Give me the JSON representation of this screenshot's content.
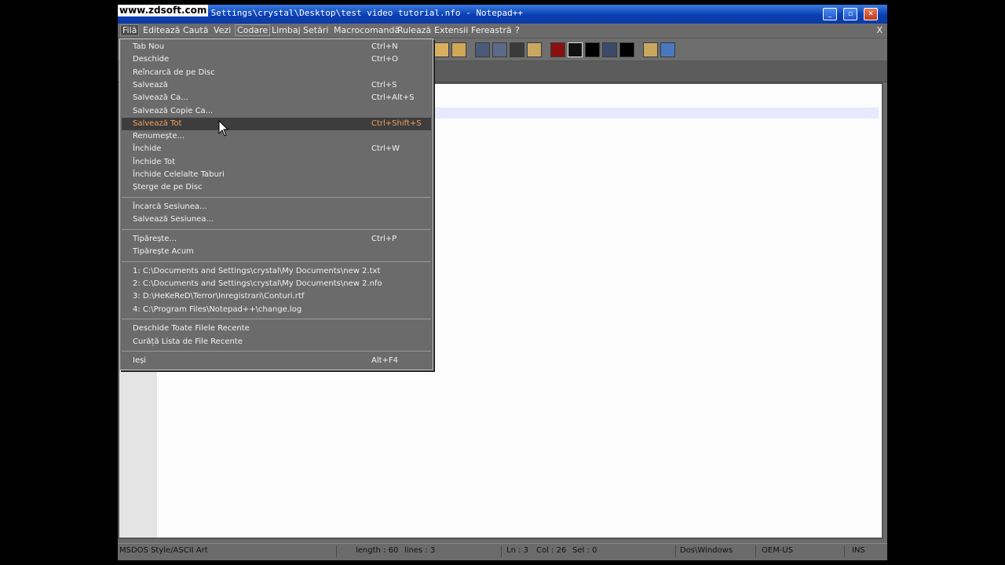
{
  "watermark": "www.zdsoft.com",
  "window": {
    "title": "C:\\Documents and Settings\\crystal\\Desktop\\test video tutorial.nfo - Notepad++",
    "minimize": "_",
    "restore": "▫",
    "close": "✕"
  },
  "menubar": {
    "items": [
      "Filă",
      "Editează",
      "Caută",
      "Vezi",
      "Codare",
      "Limbaj",
      "Setări",
      "Macrocomandă",
      "Rulează",
      "Extensii",
      "Fereastră",
      "?"
    ],
    "close": "X"
  },
  "toolbar": {
    "icons": [
      "find-in-files-icon",
      "replace-icon",
      "word-wrap-icon",
      "show-all-chars-icon",
      "indent-guide-icon",
      "user-lang-icon",
      "record-macro-icon",
      "stop-record-icon",
      "play-macro-icon",
      "run-macro-multiple-icon",
      "save-macro-icon",
      "print-icon",
      "spell-check-icon"
    ]
  },
  "file_menu": {
    "groups": [
      [
        {
          "label": "Tab Nou",
          "shortcut": "Ctrl+N"
        },
        {
          "label": "Deschide",
          "shortcut": "Ctrl+O"
        },
        {
          "label": "Reîncarcă de pe Disc",
          "shortcut": ""
        },
        {
          "label": "Salvează",
          "shortcut": "Ctrl+S"
        },
        {
          "label": "Salvează Ca...",
          "shortcut": "Ctrl+Alt+S"
        },
        {
          "label": "Salvează Copie Ca...",
          "shortcut": ""
        },
        {
          "label": "Salvează Tot",
          "shortcut": "Ctrl+Shift+S",
          "highlighted": true
        },
        {
          "label": "Renumește...",
          "shortcut": ""
        },
        {
          "label": "Închide",
          "shortcut": "Ctrl+W"
        },
        {
          "label": "Închide Tot",
          "shortcut": ""
        },
        {
          "label": "Închide Celelalte Taburi",
          "shortcut": ""
        },
        {
          "label": "Șterge de pe Disc",
          "shortcut": ""
        }
      ],
      [
        {
          "label": "Încarcă Sesiunea...",
          "shortcut": ""
        },
        {
          "label": "Salvează Sesiunea...",
          "shortcut": ""
        }
      ],
      [
        {
          "label": "Tipărește...",
          "shortcut": "Ctrl+P"
        },
        {
          "label": "Tipărește Acum",
          "shortcut": ""
        }
      ],
      [
        {
          "label": "1: C:\\Documents and Settings\\crystal\\My Documents\\new  2.txt",
          "shortcut": ""
        },
        {
          "label": "2: C:\\Documents and Settings\\crystal\\My Documents\\new  2.nfo",
          "shortcut": ""
        },
        {
          "label": "3: D:\\HeKeReD\\Terror\\Inregistrari\\Conturi.rtf",
          "shortcut": ""
        },
        {
          "label": "4: C:\\Program Files\\Notepad++\\change.log",
          "shortcut": ""
        }
      ],
      [
        {
          "label": "Deschide Toate Filele Recente",
          "shortcut": ""
        },
        {
          "label": "Curăță Lista de File Recente",
          "shortcut": ""
        }
      ],
      [
        {
          "label": "Ieși",
          "shortcut": "Alt+F4"
        }
      ]
    ]
  },
  "statusbar": {
    "file_type": "MSDOS Style/ASCII Art",
    "length": "length : 60",
    "lines": "lines : 3",
    "ln": "Ln : 3",
    "col": "Col : 26",
    "sel": "Sel : 0",
    "eol": "Dos\\Windows",
    "encoding": "OEM-US",
    "mode": "INS"
  }
}
